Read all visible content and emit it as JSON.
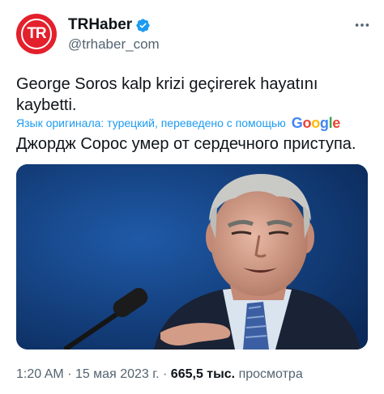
{
  "account": {
    "avatar_text": "TR",
    "display_name": "TRHaber",
    "handle": "@trhaber_com",
    "verified": true,
    "brand_color": "#e3202c"
  },
  "icons": {
    "verified": "verified-badge-icon",
    "more": "more-dots-icon",
    "google": "google-logo"
  },
  "tweet": {
    "text": "George Soros kalp krizi geçirerek hayatını kaybetti.",
    "translation_note": "Язык оригинала: турецкий, переведено с помощью",
    "translation_provider": "Google",
    "translated_text": "Джордж Сорос умер от сердечного приступа."
  },
  "meta": {
    "time": "1:20 AM",
    "separator": "·",
    "date": "15 мая 2023 г.",
    "views_count": "665,5 тыс.",
    "views_label": "просмотра"
  },
  "colors": {
    "link": "#1d9bf0",
    "secondary": "#536471",
    "text": "#0f1419",
    "photo_background": "#10386e"
  }
}
